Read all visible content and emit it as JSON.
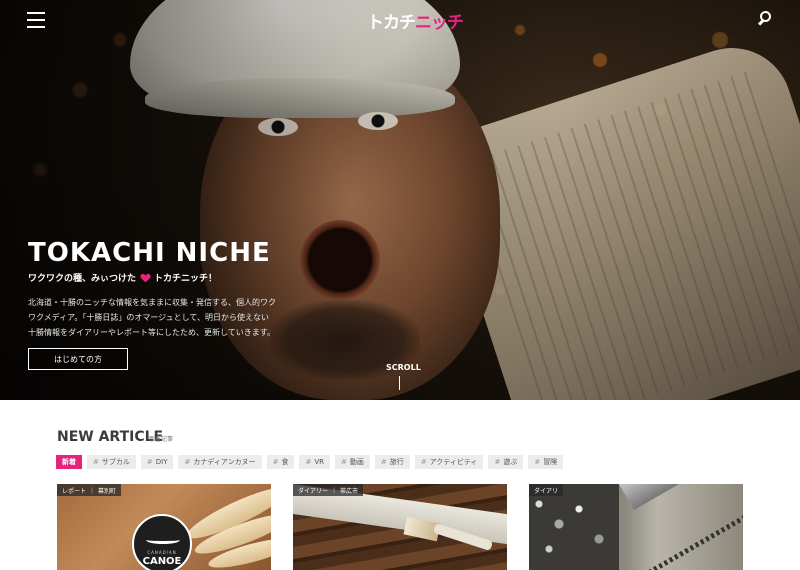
{
  "header": {
    "logo_main": "トカチ",
    "logo_accent": "ニッチ"
  },
  "hero": {
    "title": "TOKACHI NICHE",
    "tagline_pre": "ワクワクの種、みぃつけた",
    "tagline_post": "トカチニッチ！",
    "description": [
      "北海道・十勝のニッチな情報を気ままに収集・発信する、個人的ワク",
      "ワクメディア。「十勝日誌」のオマージュとして、明日から使えない",
      "十勝情報をダイアリーやレポート等にしたため、更新していきます。"
    ],
    "cta_label": "はじめての方",
    "scroll_label": "SCROLL"
  },
  "new_article": {
    "title": "NEW ARTICLE",
    "subtitle": "新着記事",
    "tags": [
      {
        "label": "新着",
        "active": true
      },
      {
        "label": "サブカル"
      },
      {
        "label": "DIY"
      },
      {
        "label": "カナディアンカヌー"
      },
      {
        "label": "食"
      },
      {
        "label": "VR"
      },
      {
        "label": "動画"
      },
      {
        "label": "旅行"
      },
      {
        "label": "アクティビティ"
      },
      {
        "label": "遊ぶ"
      },
      {
        "label": "冒険"
      }
    ],
    "cards": [
      {
        "category": "レポート",
        "location": "幕別町",
        "badge_small": "CANADIAN",
        "badge_big": "CANOE"
      },
      {
        "category": "ダイアリー",
        "location": "帯広市"
      },
      {
        "category": "ダイアリ",
        "location": ""
      }
    ]
  },
  "colors": {
    "accent": "#e6237e",
    "hero_text": "#ffffff",
    "tag_bg": "#ececec"
  }
}
